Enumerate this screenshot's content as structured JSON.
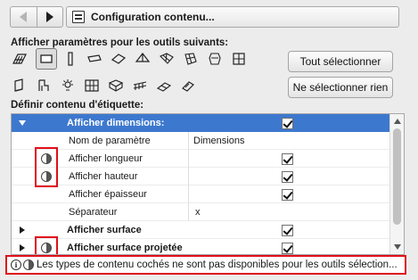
{
  "header": {
    "title": "Configuration contenu..."
  },
  "tools_section": {
    "label": "Afficher paramètres pour les outils suivants:",
    "row1_icons": [
      "slab-tool-icon",
      "wall-tool-icon",
      "column-tool-icon",
      "beam-tool-icon",
      "roof-tool-icon",
      "shell-tool-icon",
      "mesh-tool-icon",
      "morph-tool-icon",
      "object-tool-icon",
      "window-tool-icon"
    ],
    "row2_icons": [
      "door-tool-icon",
      "stair-tool-icon",
      "lamp-tool-icon",
      "curtain-wall-tool-icon",
      "zone-tool-icon",
      "railing-tool-icon",
      "skylight-tool-icon",
      "opening-tool-icon"
    ],
    "selected_tool": "wall-tool-icon",
    "select_all_label": "Tout sélectionner",
    "select_none_label": "Ne sélectionner rien"
  },
  "content_section": {
    "label": "Définir contenu d'étiquette:"
  },
  "table": {
    "rows": [
      {
        "label": "Afficher dimensions:",
        "value": "",
        "checked": true,
        "kind": "header"
      },
      {
        "label": "Nom de paramètre",
        "value": "Dimensions",
        "checked": null,
        "kind": "item"
      },
      {
        "label": "Afficher longueur",
        "value": "",
        "checked": true,
        "kind": "item"
      },
      {
        "label": "Afficher hauteur",
        "value": "",
        "checked": true,
        "kind": "item"
      },
      {
        "label": "Afficher épaisseur",
        "value": "",
        "checked": true,
        "kind": "item"
      },
      {
        "label": "Séparateur",
        "value": "x",
        "checked": null,
        "kind": "item"
      },
      {
        "label": "Afficher surface",
        "value": "",
        "checked": true,
        "kind": "group"
      },
      {
        "label": "Afficher surface projetée",
        "value": "",
        "checked": true,
        "kind": "group"
      }
    ]
  },
  "footer": {
    "message": "Les types de contenu cochés ne sont pas disponibles pour les outils sélection..."
  },
  "colors": {
    "selection": "#3d78cf",
    "highlight": "#e0101a"
  }
}
